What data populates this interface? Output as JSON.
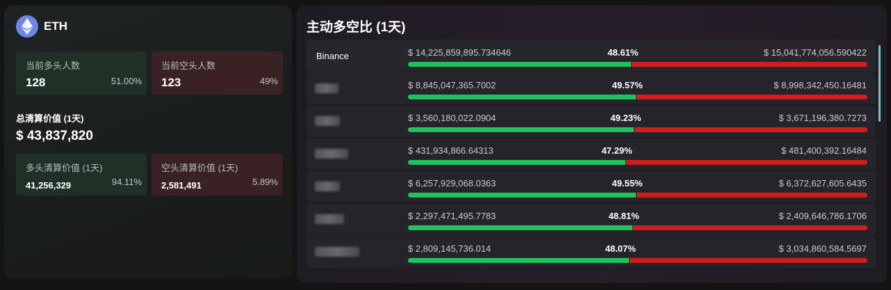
{
  "left": {
    "coin": {
      "name": "ETH",
      "icon": "ethereum-icon",
      "color": "#6c85e8"
    },
    "long_count": {
      "label": "当前多头人数",
      "value": "128",
      "pct": "51.00%"
    },
    "short_count": {
      "label": "当前空头人数",
      "value": "123",
      "pct": "49%"
    },
    "total": {
      "label": "总清算价值 (1天)",
      "value": "$ 43,837,820"
    },
    "long_liq": {
      "label": "多头清算价值 (1天)",
      "value": "41,256,329",
      "pct": "94.11%"
    },
    "short_liq": {
      "label": "空头清算价值 (1天)",
      "value": "2,581,491",
      "pct": "5.89%"
    }
  },
  "right": {
    "title": "主动多空比 (1天)",
    "rows": [
      {
        "exchange": "Binance",
        "redacted": false,
        "long": "$ 14,225,859,895.734646",
        "pct": "48.61%",
        "ratio": 0.4861,
        "short": "$ 15,041,774,056.590422"
      },
      {
        "exchange": "",
        "redacted": true,
        "long": "$ 8,845,047,365.7002",
        "pct": "49.57%",
        "ratio": 0.4957,
        "short": "$ 8,998,342,450.16481"
      },
      {
        "exchange": "",
        "redacted": true,
        "long": "$ 3,560,180,022.0904",
        "pct": "49.23%",
        "ratio": 0.4923,
        "short": "$ 3,671,196,380.7273"
      },
      {
        "exchange": "",
        "redacted": true,
        "long": "$ 431,934,866.64313",
        "pct": "47.29%",
        "ratio": 0.4729,
        "short": "$ 481,400,392.16484"
      },
      {
        "exchange": "",
        "redacted": true,
        "long": "$ 6,257,929,068.0363",
        "pct": "49.55%",
        "ratio": 0.4955,
        "short": "$ 6,372,627,605.6435"
      },
      {
        "exchange": "",
        "redacted": true,
        "long": "$ 2,297,471,495.7783",
        "pct": "48.81%",
        "ratio": 0.4881,
        "short": "$ 2,409,646,786.1706"
      },
      {
        "exchange": "",
        "redacted": true,
        "long": "$ 2,809,145,736.014",
        "pct": "48.07%",
        "ratio": 0.4807,
        "short": "$ 3,034,860,584.5697"
      }
    ]
  },
  "colors": {
    "long": "#1fc25c",
    "short": "#d21d1d",
    "scrollbar": "#7bc4cf"
  }
}
